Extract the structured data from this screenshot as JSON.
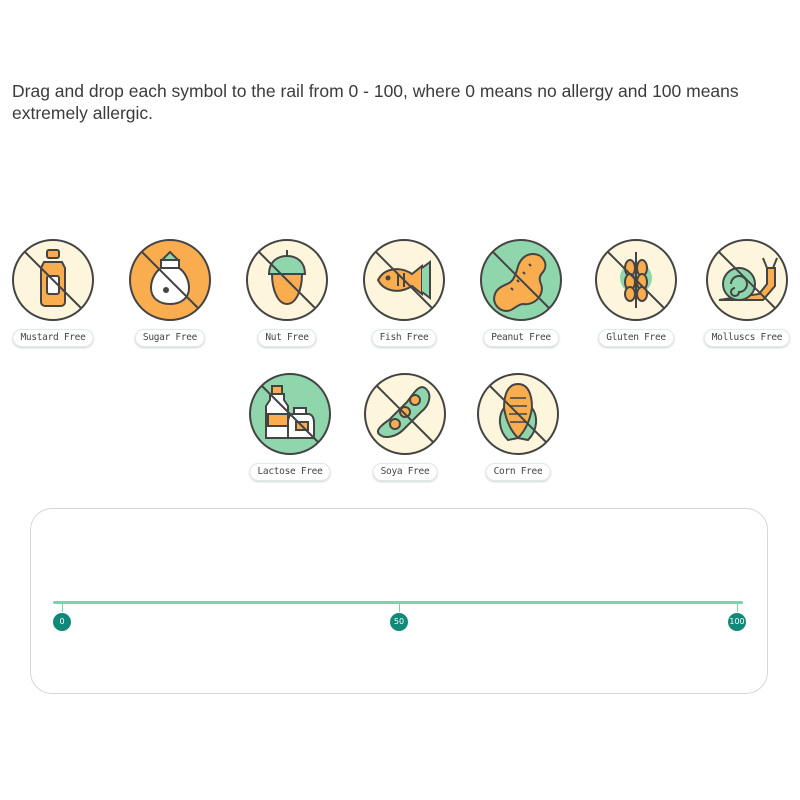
{
  "instructions": "Drag and drop each symbol to the rail from 0 - 100, where 0 means no allergy and 100 means extremely allergic.",
  "symbols": [
    {
      "label": "Mustard Free",
      "icon": "mustard-icon",
      "bg": "#fdf6dc"
    },
    {
      "label": "Sugar Free",
      "icon": "sugar-icon",
      "bg": "#f9ad4f"
    },
    {
      "label": "Nut Free",
      "icon": "nut-icon",
      "bg": "#fdf6dc"
    },
    {
      "label": "Fish Free",
      "icon": "fish-icon",
      "bg": "#fdf6dc"
    },
    {
      "label": "Peanut Free",
      "icon": "peanut-icon",
      "bg": "#8fd6ad"
    },
    {
      "label": "Gluten Free",
      "icon": "wheat-icon",
      "bg": "#fdf6dc"
    },
    {
      "label": "Molluscs Free",
      "icon": "snail-icon",
      "bg": "#fdf6dc"
    },
    {
      "label": "Lactose Free",
      "icon": "milk-icon",
      "bg": "#8fd6ad"
    },
    {
      "label": "Soya Free",
      "icon": "soya-icon",
      "bg": "#fdf6dc"
    },
    {
      "label": "Corn Free",
      "icon": "corn-icon",
      "bg": "#fdf6dc"
    }
  ],
  "rail": {
    "ticks": [
      "0",
      "50",
      "100"
    ],
    "line_color": "#7dd3a9",
    "marker_color": "#0f8a7a"
  },
  "colors": {
    "outline": "#444444",
    "orange": "#f9ad4f",
    "green": "#8fd6ad",
    "cream": "#fdf6dc"
  }
}
